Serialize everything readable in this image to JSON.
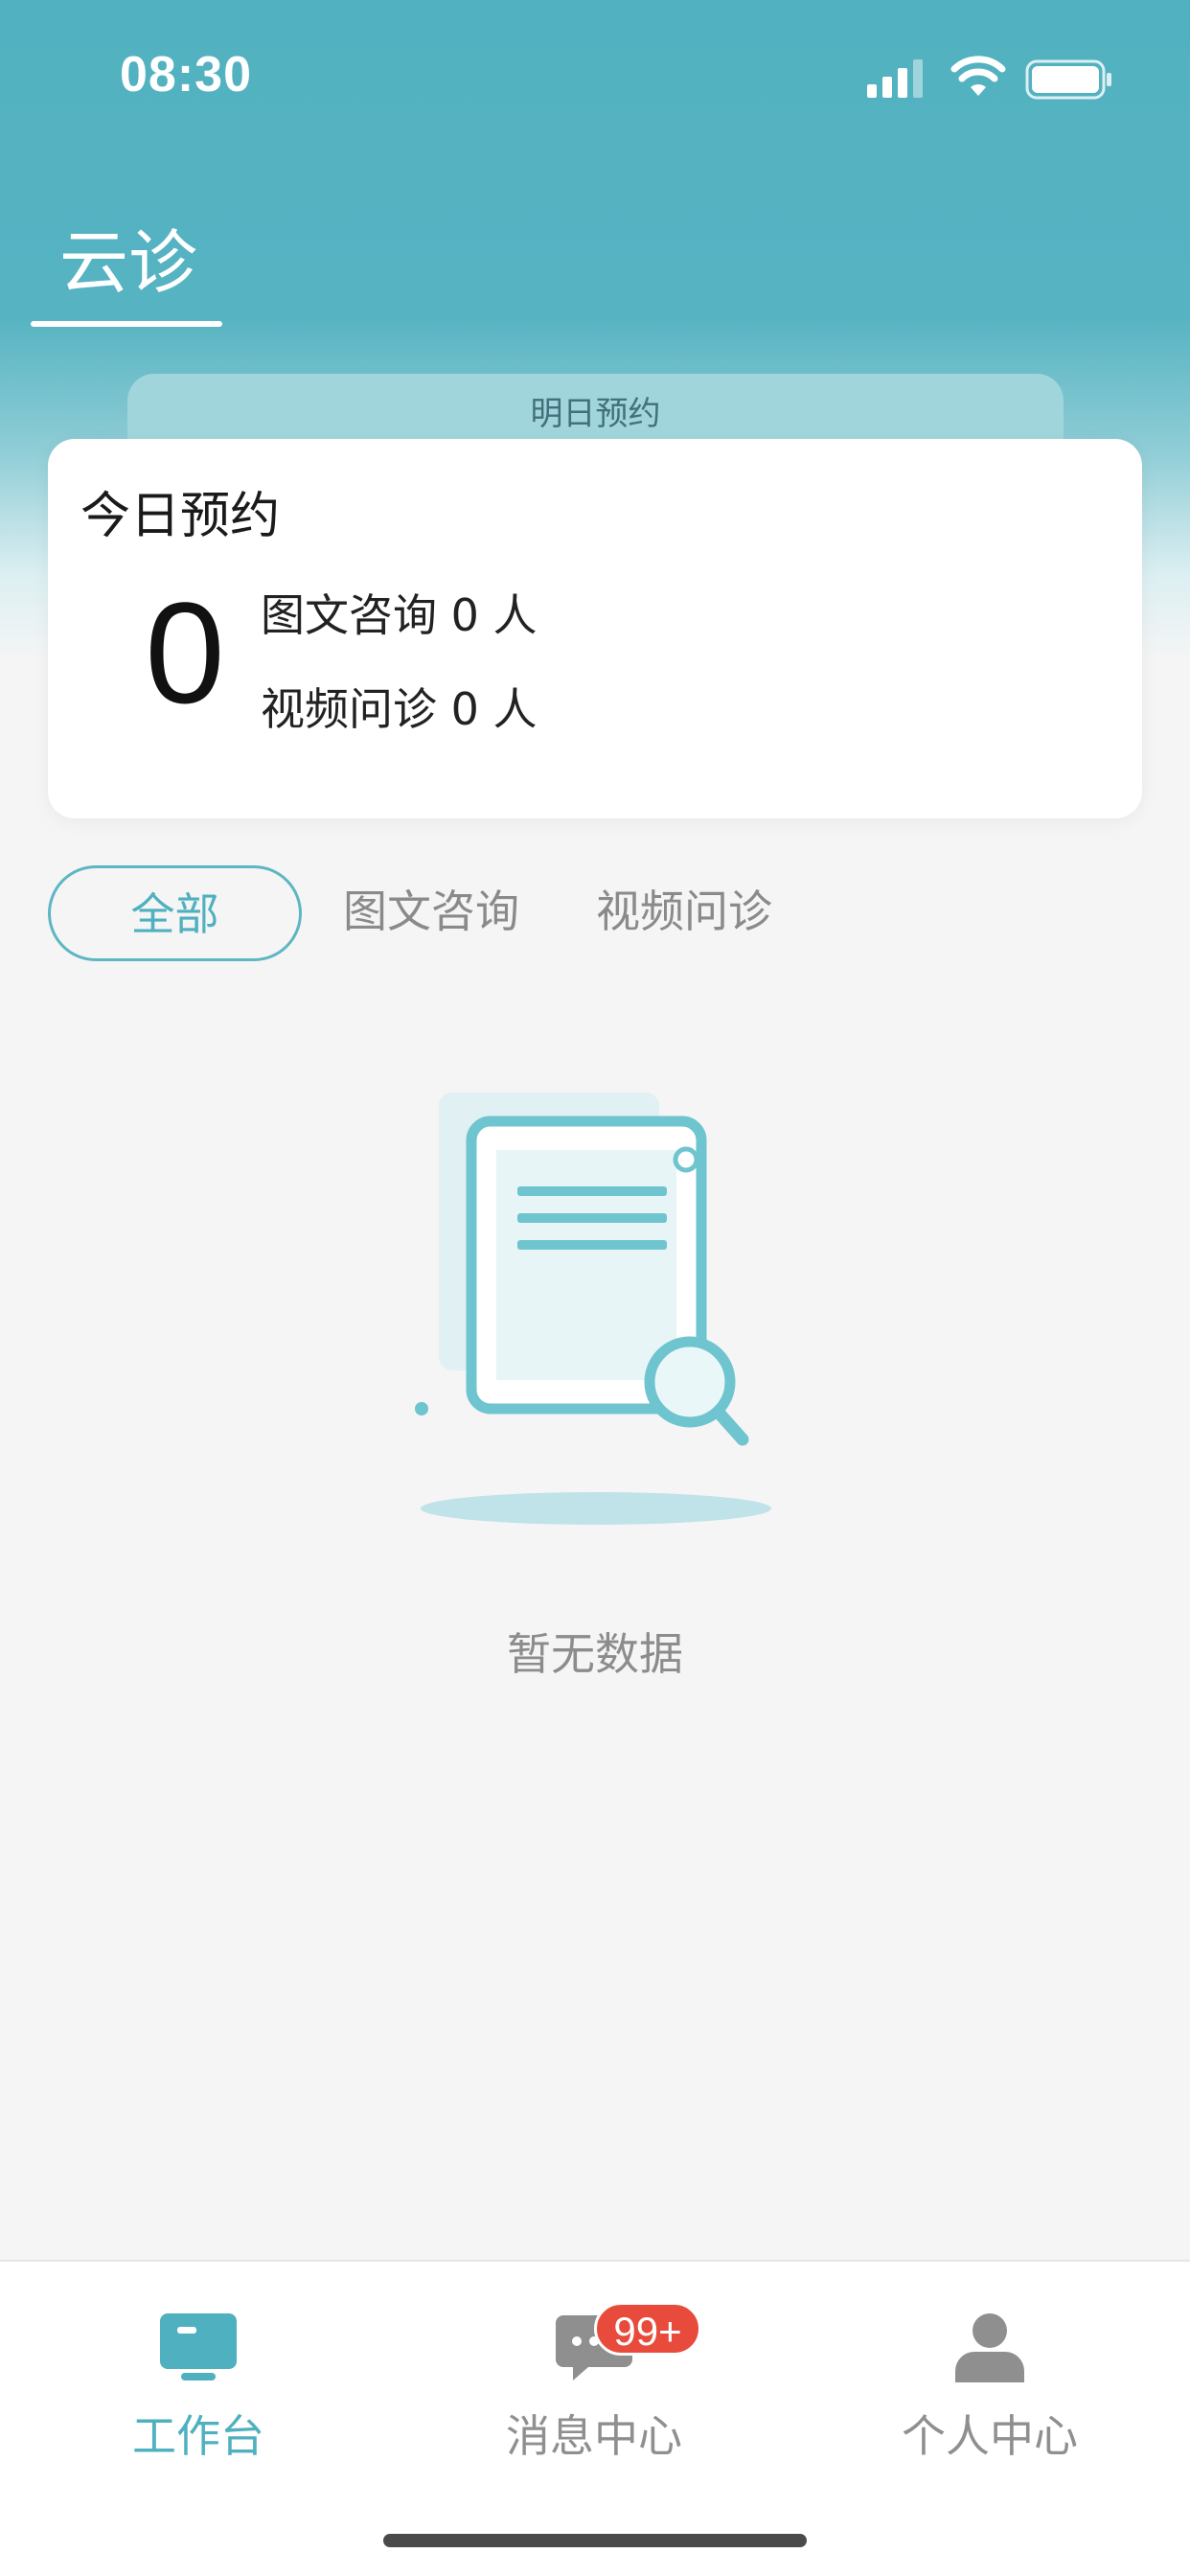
{
  "status_bar": {
    "time": "08:30"
  },
  "header": {
    "tab_label": "云诊"
  },
  "tomorrow": {
    "label": "明日预约"
  },
  "today": {
    "title": "今日预约",
    "total": "0",
    "text_consult": "图文咨询 0 人",
    "video_consult": "视频问诊 0 人"
  },
  "filters": {
    "all": "全部",
    "text": "图文咨询",
    "video": "视频问诊"
  },
  "empty": {
    "text": "暂无数据"
  },
  "tabbar": {
    "workbench": "工作台",
    "messages": "消息中心",
    "messages_badge": "99+",
    "profile": "个人中心"
  },
  "colors": {
    "accent": "#4fb0bf",
    "header": "#56b3c2",
    "badge": "#e84b3c"
  }
}
